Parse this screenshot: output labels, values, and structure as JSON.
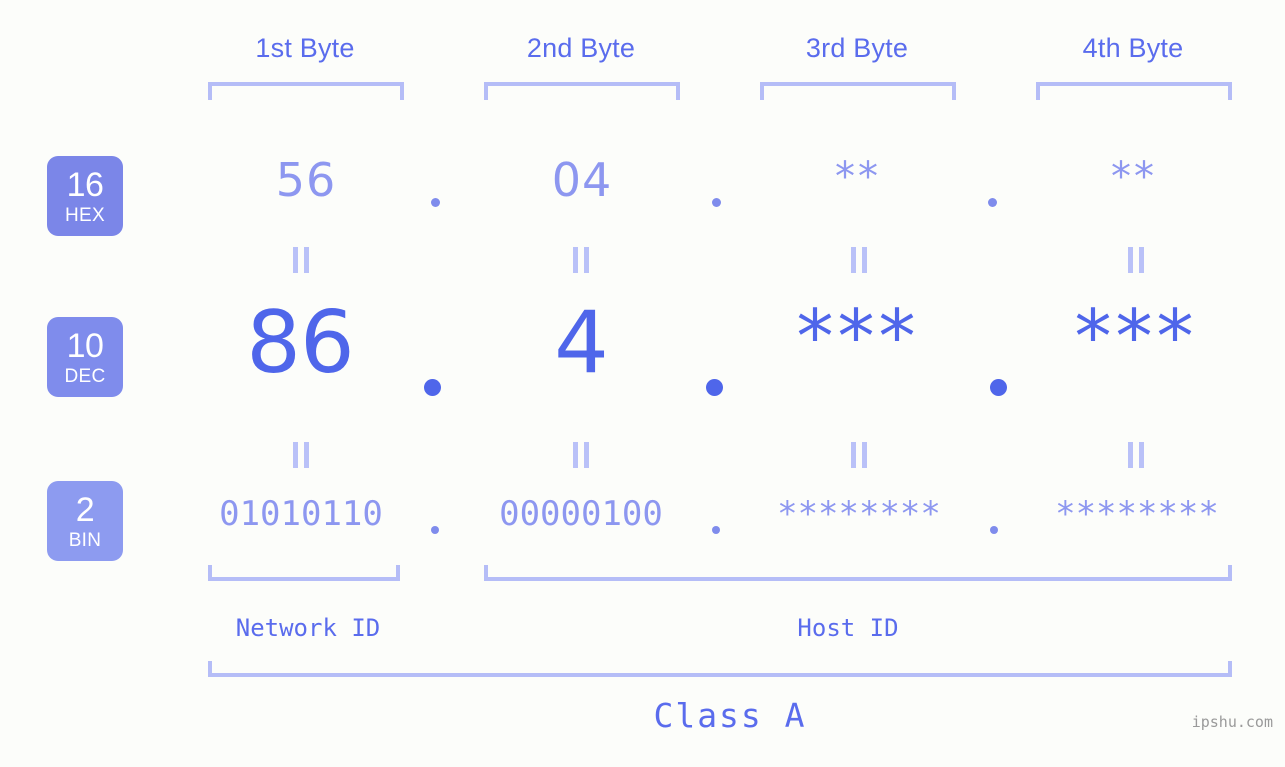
{
  "watermark": "ipshu.com",
  "colors": {
    "background": "#fcfdfa",
    "accent_strong": "#4f66ea",
    "accent_mid": "#7b86e8",
    "accent_light": "#8d97f0",
    "bracket": "#b5bdf7",
    "badge_hex": "#7b86e8",
    "badge_dec": "#7f8cec",
    "badge_bin": "#8d9bf0",
    "watermark_gray": "#9a9a9a"
  },
  "byte_headers": [
    {
      "label": "1st Byte"
    },
    {
      "label": "2nd Byte"
    },
    {
      "label": "3rd Byte"
    },
    {
      "label": "4th Byte"
    }
  ],
  "radix_badges": [
    {
      "num": "16",
      "label": "HEX"
    },
    {
      "num": "10",
      "label": "DEC"
    },
    {
      "num": "2",
      "label": "BIN"
    }
  ],
  "rows": {
    "hex": {
      "values": [
        "56",
        "04",
        "**",
        "**"
      ],
      "separator": "."
    },
    "dec": {
      "values": [
        "86",
        "4",
        "***",
        "***"
      ],
      "separator": "."
    },
    "bin": {
      "values": [
        "01010110",
        "00000100",
        "********",
        "********"
      ],
      "separator": "."
    }
  },
  "equals_marks": {
    "symbol": "=",
    "count_per_row": 4
  },
  "sections": [
    {
      "label": "Network ID"
    },
    {
      "label": "Host ID"
    }
  ],
  "class": {
    "label": "Class A"
  }
}
